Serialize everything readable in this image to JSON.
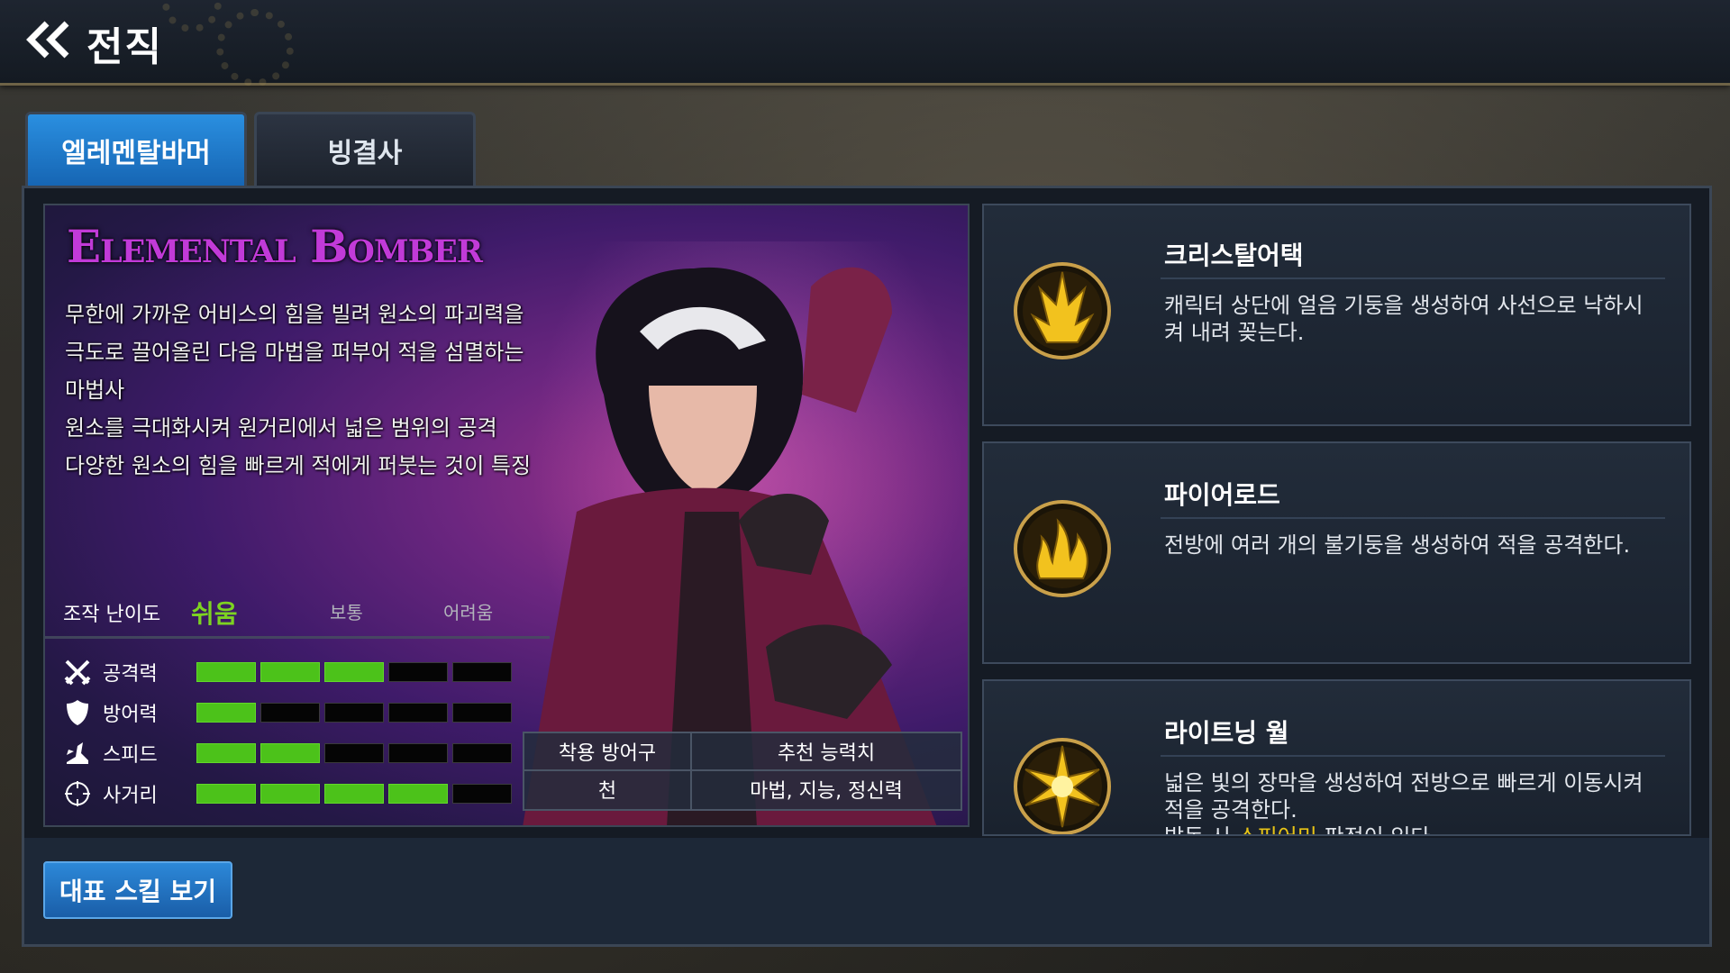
{
  "header": {
    "title": "전직"
  },
  "tabs": [
    {
      "label": "엘레멘탈바머",
      "active": true
    },
    {
      "label": "빙결사",
      "active": false
    }
  ],
  "character": {
    "class_name": "Elemental Bomber",
    "description": [
      "무한에 가까운 어비스의 힘을 빌려 원소의 파괴력을",
      "극도로 끌어올린 다음 마법을 퍼부어 적을 섬멸하는",
      "마법사",
      "원소를 극대화시켜 원거리에서 넓은 범위의 공격",
      "다양한 원소의 힘을 빠르게 적에게 퍼붓는 것이 특징"
    ],
    "difficulty": {
      "label": "조작 난이도",
      "levels": [
        "쉬움",
        "보통",
        "어려움"
      ],
      "selected": "쉬움",
      "selected_color": "#7dd321"
    },
    "stats": [
      {
        "label": "공격력",
        "icon": "crossed-swords-icon",
        "value": 3,
        "max": 5
      },
      {
        "label": "방어력",
        "icon": "shield-icon",
        "value": 1,
        "max": 5
      },
      {
        "label": "스피드",
        "icon": "winged-boot-icon",
        "value": 2,
        "max": 5
      },
      {
        "label": "사거리",
        "icon": "crosshair-icon",
        "value": 4,
        "max": 5
      }
    ],
    "equipment": {
      "headers": [
        "착용 방어구",
        "추천 능력치"
      ],
      "values": [
        "천",
        "마법, 지능, 정신력"
      ]
    }
  },
  "skills": [
    {
      "name": "크리스탈어택",
      "icon": "ice-crystal-icon",
      "description": [
        "캐릭터 상단에 얼음 기둥을 생성하여 사선으로 낙하시",
        "켜 내려 꽂는다."
      ]
    },
    {
      "name": "파이어로드",
      "icon": "fire-pillar-icon",
      "description": [
        "전방에 여러 개의 불기둥을 생성하여 적을 공격한다."
      ]
    },
    {
      "name": "라이트닝 월",
      "icon": "lightning-burst-icon",
      "description": [
        "넓은 빛의 장막을 생성하여 전방으로 빠르게 이동시켜",
        "적을 공격한다."
      ],
      "extra_prefix": "발동 시 ",
      "extra_highlight": "스피어미",
      "extra_suffix": " 판정이 있다"
    }
  ],
  "footer": {
    "skill_button": "대표 스킬 보기"
  },
  "colors": {
    "accent_blue": "#1f7ad0",
    "stat_bar_on": "#4cc21a",
    "class_name": "#c13ad8",
    "highlight": "#e8c416"
  }
}
